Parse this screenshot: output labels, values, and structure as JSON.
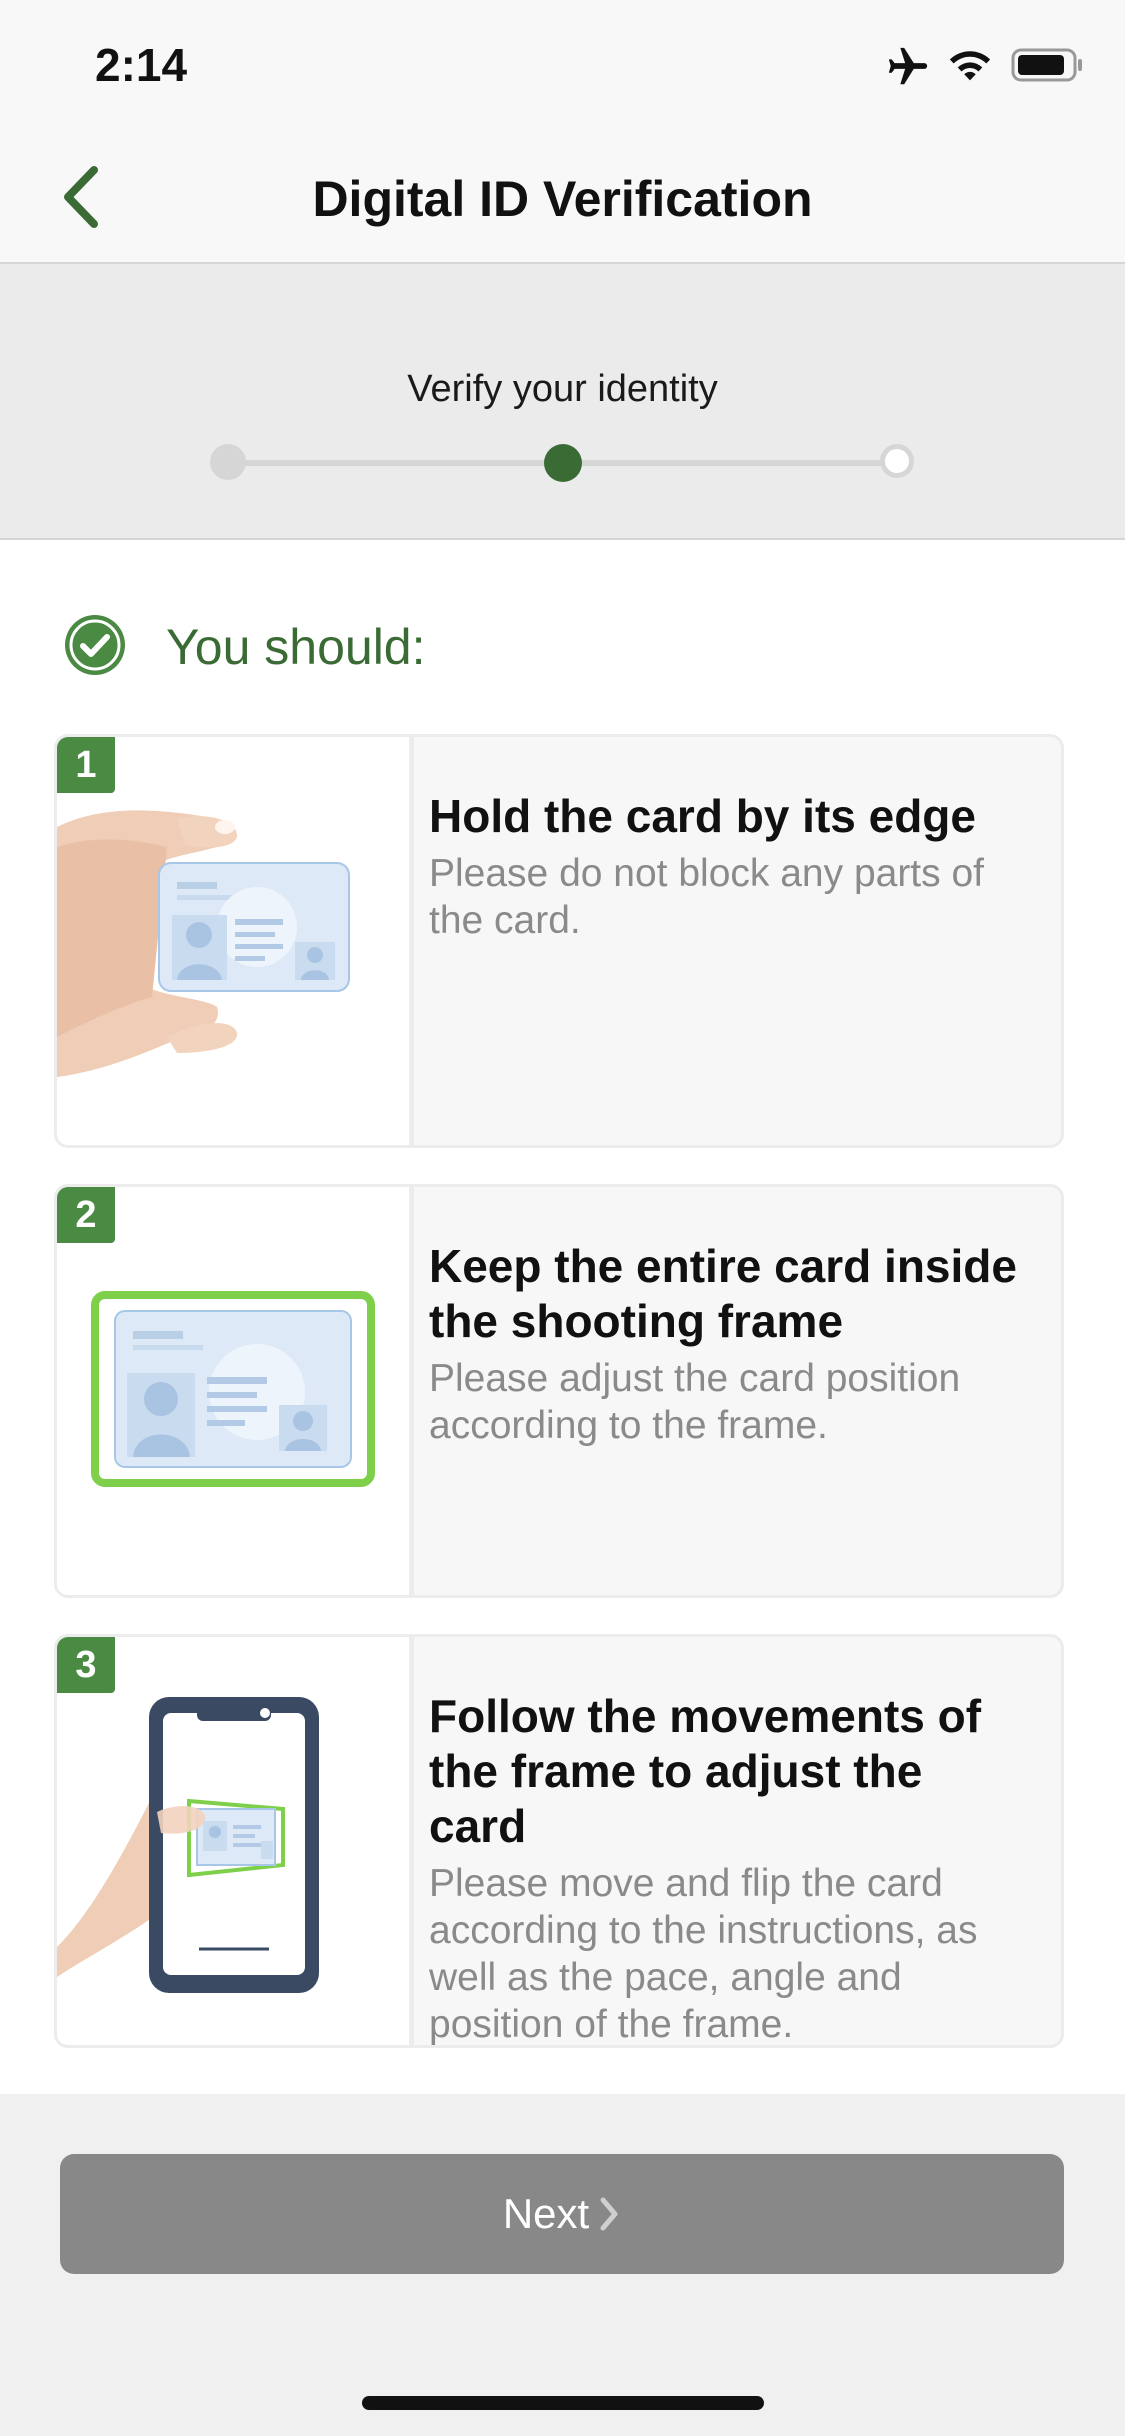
{
  "status_bar": {
    "time": "2:14",
    "icons": [
      "airplane-icon",
      "wifi-icon",
      "battery-icon"
    ]
  },
  "nav": {
    "title": "Digital ID Verification",
    "back_icon": "chevron-left-icon"
  },
  "progress": {
    "label": "Verify your identity",
    "total_steps": 3,
    "current_step": 2
  },
  "section": {
    "heading": "You should:"
  },
  "steps": [
    {
      "number": "1",
      "title": "Hold the card by its edge",
      "description": "Please do not block any parts of the card.",
      "illustration": "hand-holding-card"
    },
    {
      "number": "2",
      "title": "Keep the entire card inside the shooting frame",
      "description": "Please adjust the card position according to the frame.",
      "illustration": "card-in-frame"
    },
    {
      "number": "3",
      "title": "Follow the movements of the frame to adjust the card",
      "description": "Please move and flip the card according to the instructions, as well as the pace, angle and position of the frame.",
      "illustration": "phone-scanning-card"
    }
  ],
  "footer": {
    "next_label": "Next",
    "next_enabled": false
  },
  "colors": {
    "accent_green": "#3b6b35",
    "badge_green": "#4a8a42",
    "frame_green": "#7ed04a",
    "button_disabled": "#888888"
  }
}
